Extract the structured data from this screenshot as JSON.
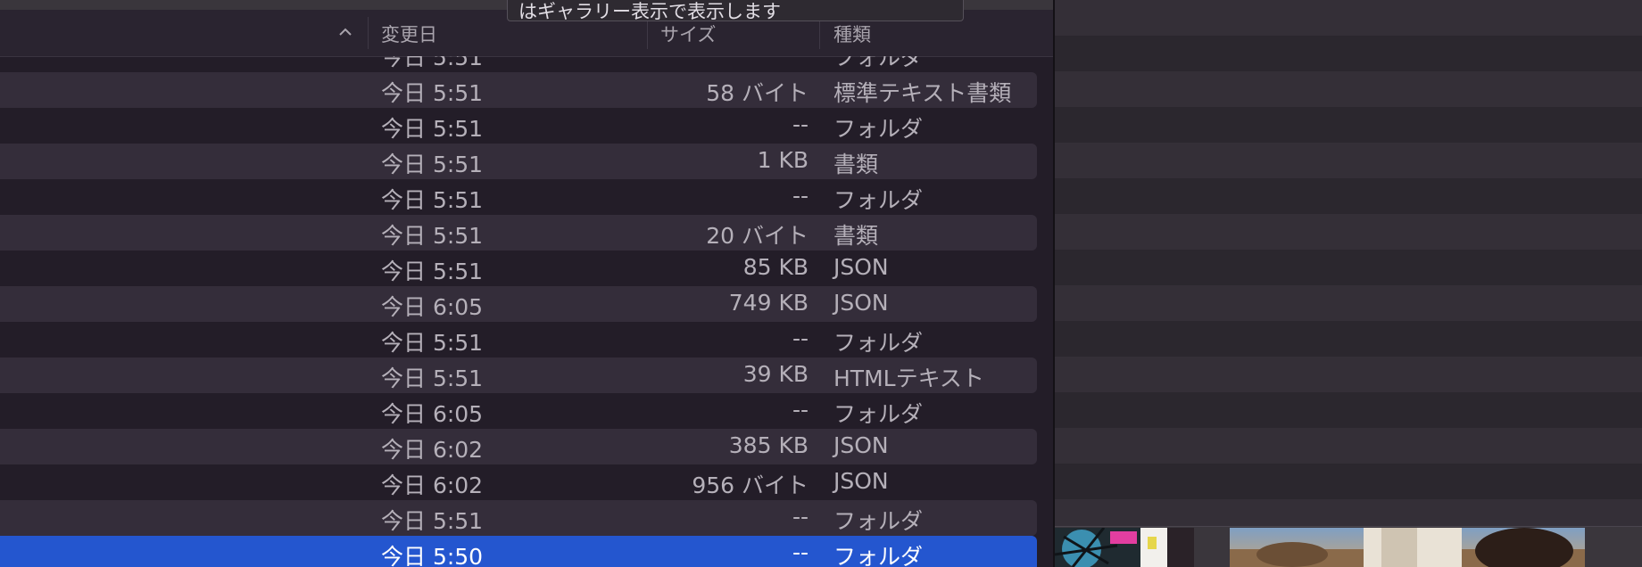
{
  "tooltip": {
    "text": "はギャラリー表示で表示します"
  },
  "columns": {
    "modified": "変更日",
    "size": "サイズ",
    "kind": "種類"
  },
  "partial_top_row": {
    "date": "今日 5:51",
    "kind": "フォルダ"
  },
  "rows": [
    {
      "date": "今日 5:51",
      "size": "58 バイト",
      "kind": "標準テキスト書類"
    },
    {
      "date": "今日 5:51",
      "size": "--",
      "kind": "フォルダ"
    },
    {
      "date": "今日 5:51",
      "size": "1 KB",
      "kind": "書類"
    },
    {
      "date": "今日 5:51",
      "size": "--",
      "kind": "フォルダ"
    },
    {
      "date": "今日 5:51",
      "size": "20 バイト",
      "kind": "書類"
    },
    {
      "date": "今日 5:51",
      "size": "85 KB",
      "kind": "JSON"
    },
    {
      "date": "今日 6:05",
      "size": "749 KB",
      "kind": "JSON"
    },
    {
      "date": "今日 5:51",
      "size": "--",
      "kind": "フォルダ"
    },
    {
      "date": "今日 5:51",
      "size": "39 KB",
      "kind": "HTMLテキスト"
    },
    {
      "date": "今日 6:05",
      "size": "--",
      "kind": "フォルダ"
    },
    {
      "date": "今日 6:02",
      "size": "385 KB",
      "kind": "JSON"
    },
    {
      "date": "今日 6:02",
      "size": "956 バイト",
      "kind": "JSON"
    },
    {
      "date": "今日 5:51",
      "size": "--",
      "kind": "フォルダ"
    },
    {
      "date": "今日 5:50",
      "size": "--",
      "kind": "フォルダ",
      "selected": true
    }
  ],
  "icons": {
    "sort": "chevron-up-icon"
  },
  "colors": {
    "selection": "#2456cf",
    "background": "#231d28",
    "stripe": "#342d3a"
  }
}
